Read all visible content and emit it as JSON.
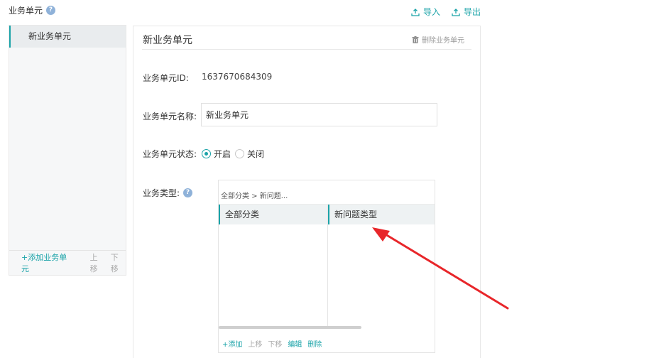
{
  "header": {
    "title": "业务单元",
    "help_icon": "?",
    "import_label": "导入",
    "export_label": "导出"
  },
  "left_panel": {
    "items": [
      {
        "label": "新业务单元",
        "active": true
      }
    ],
    "add_label": "+添加业务单元",
    "move_up_label": "上移",
    "move_down_label": "下移"
  },
  "detail": {
    "title": "新业务单元",
    "delete_label": "删除业务单元",
    "id_label": "业务单元ID:",
    "id_value": "1637670684309",
    "name_label": "业务单元名称:",
    "name_value": "新业务单元",
    "status_label": "业务单元状态:",
    "status_options": [
      {
        "label": "开启",
        "checked": true
      },
      {
        "label": "关闭",
        "checked": false
      }
    ],
    "type_label": "业务类型:",
    "type_help_icon": "?"
  },
  "type_picker": {
    "breadcrumb": "全部分类 > 新问题...",
    "column_a": "全部分类",
    "column_b": "新问题类型",
    "actions": {
      "add": "+添加",
      "up": "上移",
      "down": "下移",
      "edit": "编辑",
      "delete": "删除"
    }
  },
  "colors": {
    "accent": "#1aa3a8",
    "annotation_arrow": "#e8262a",
    "disabled": "#aaaaaa"
  }
}
